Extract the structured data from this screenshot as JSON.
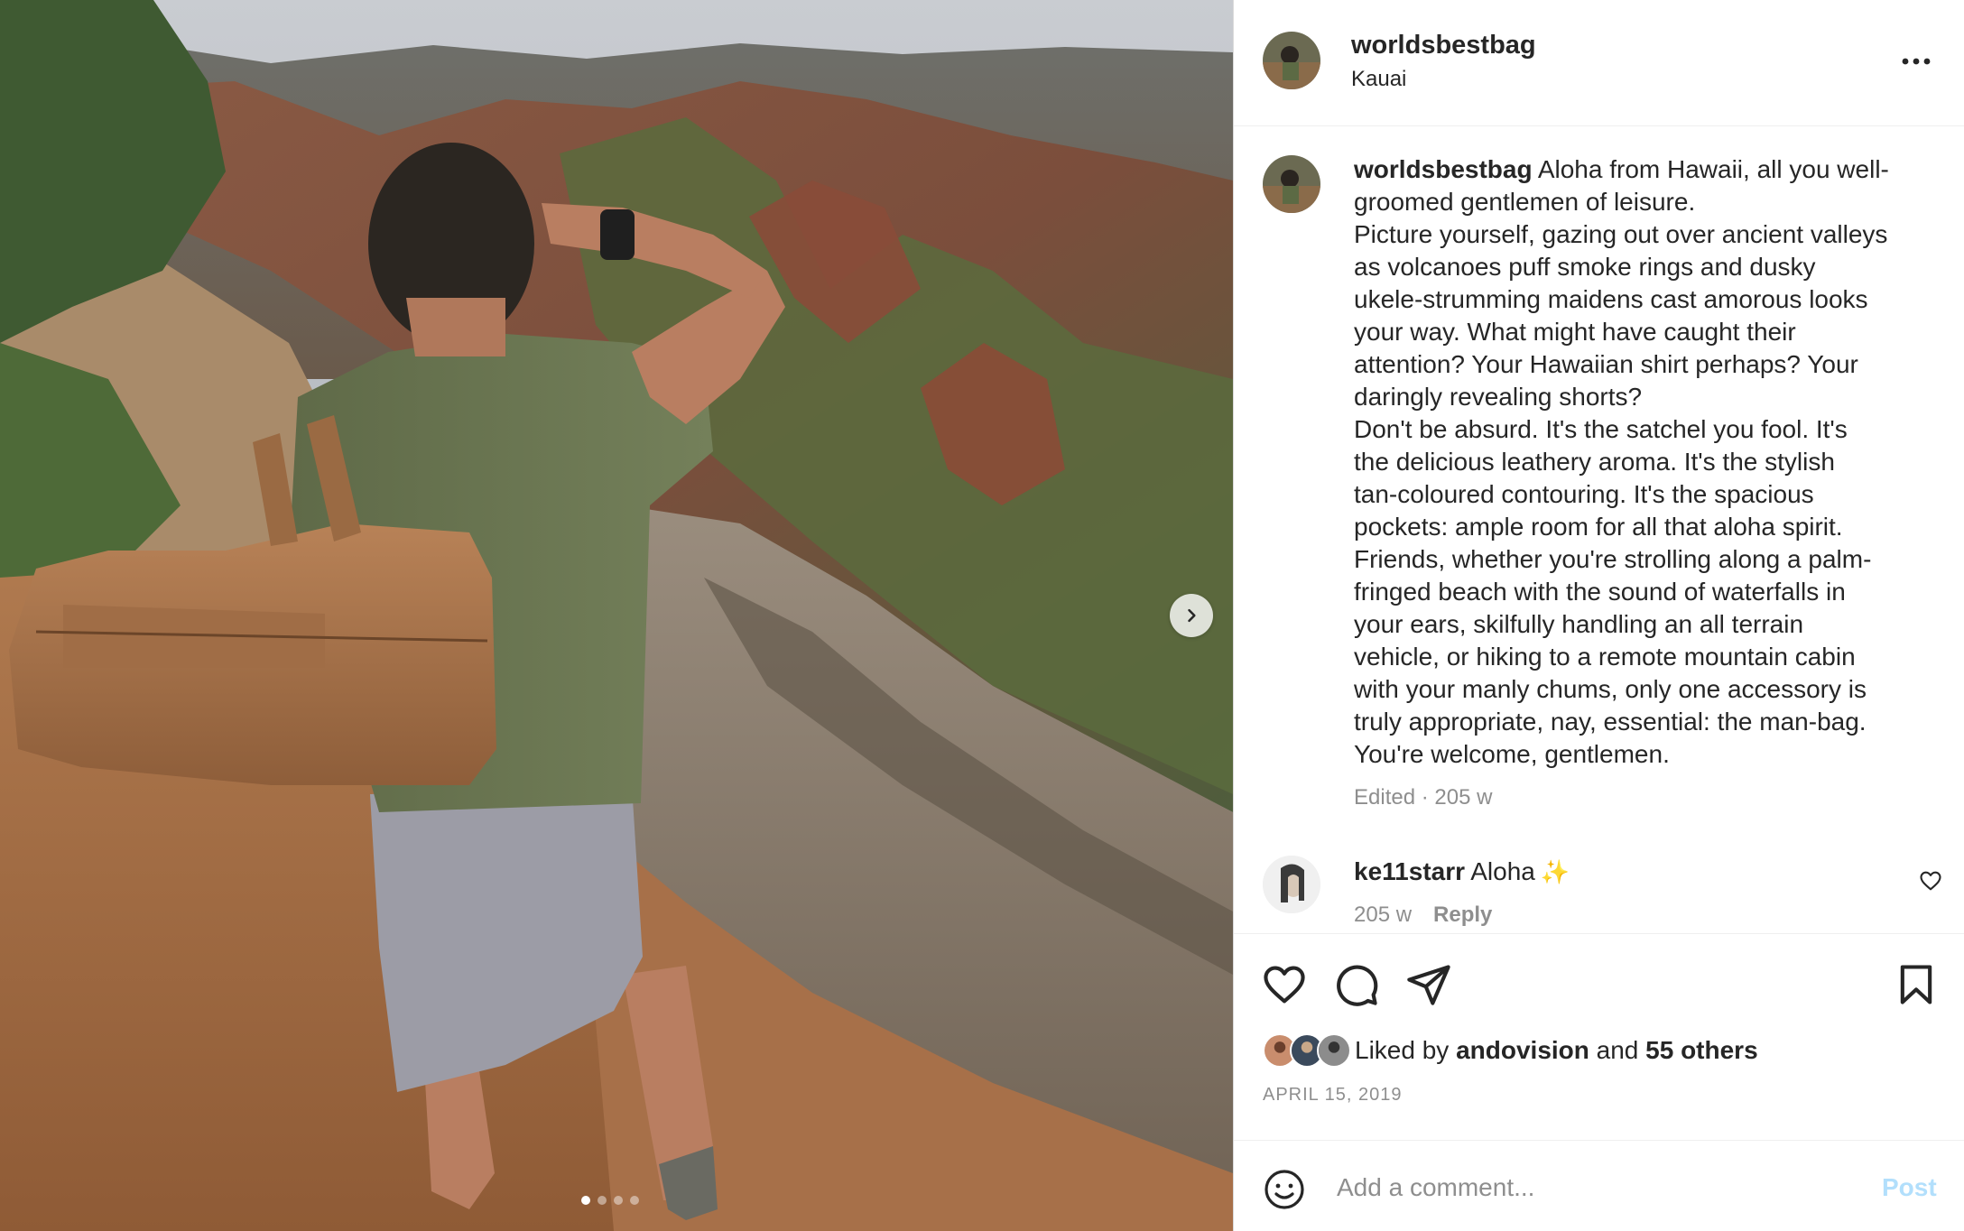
{
  "post": {
    "username": "worldsbestbag",
    "location": "Kauai",
    "caption_lines": [
      "Aloha from Hawaii, all you well-",
      "groomed gentlemen of leisure.",
      "Picture yourself, gazing out over ancient valleys",
      "as volcanoes puff smoke rings and dusky",
      "ukele-strumming maidens cast amorous looks",
      "your way. What might have caught their",
      "attention? Your Hawaiian shirt perhaps? Your",
      "daringly revealing shorts?",
      "Don't be absurd. It's the satchel you fool. It's",
      "the delicious leathery aroma. It's the stylish",
      "tan-coloured contouring. It's the spacious",
      "pockets: ample room for all that aloha spirit.",
      "Friends, whether you're strolling along a palm-",
      "fringed beach with the sound of waterfalls in",
      "your ears, skilfully handling an all terrain",
      "vehicle, or hiking to a remote mountain cabin",
      "with your manly chums, only one accessory is",
      "truly appropriate, nay, essential: the man-bag.",
      "You're welcome, gentlemen."
    ],
    "caption_meta": "Edited · 205 w",
    "likes": {
      "prefix": "Liked by",
      "user": "andovision",
      "middle": "and",
      "others": "55 others"
    },
    "date": "APRIL 15, 2019"
  },
  "comment": {
    "username": "ke11starr",
    "text": "Aloha",
    "emoji": "✨",
    "age": "205 w",
    "reply_label": "Reply"
  },
  "composer": {
    "placeholder": "Add a comment...",
    "post_label": "Post"
  },
  "carousel": {
    "slide_count": 4,
    "active_slide": 1
  },
  "icons": {
    "more": "more-horizontal-icon",
    "next": "chevron-right-icon",
    "like": "heart-icon",
    "comment": "comment-bubble-icon",
    "share": "paper-plane-icon",
    "save": "bookmark-icon",
    "emoji": "emoji-icon"
  },
  "colors": {
    "text": "#262626",
    "secondary": "#8e8e8e",
    "post_button_disabled": "#b2dffc",
    "border": "#dbdbdb"
  }
}
